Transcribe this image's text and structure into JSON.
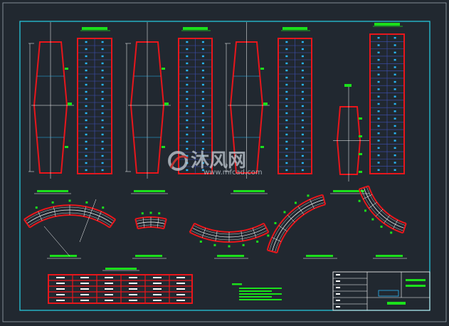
{
  "drawing": {
    "colors": {
      "background": "#212830",
      "frame": "#26c6da",
      "outline": "#e8161b",
      "grid": "#3f51b5",
      "cell": "#29b6f6",
      "label": "#1be01b",
      "axis": "#ffffff",
      "watermark": "#c0c8d0"
    },
    "watermark": {
      "brand": "沐风网",
      "url": "www.mfcad.com",
      "icon": "mfcad-logo-icon"
    },
    "elevation_views": [
      {
        "id": "pier-1",
        "table_rows": 19
      },
      {
        "id": "pier-2",
        "table_rows": 19
      },
      {
        "id": "pier-3",
        "table_rows": 19
      },
      {
        "id": "pier-4",
        "table_rows": 19
      }
    ],
    "plan_views": [
      {
        "id": "curve-1"
      },
      {
        "id": "curve-2"
      },
      {
        "id": "curve-3"
      },
      {
        "id": "curve-4"
      },
      {
        "id": "curve-5"
      }
    ],
    "summary_table": {
      "rows": 5,
      "columns": 6
    },
    "title_block": {
      "rows": 6
    }
  }
}
